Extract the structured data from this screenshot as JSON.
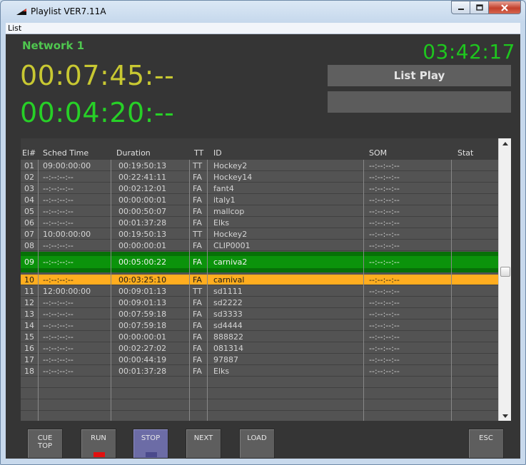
{
  "window": {
    "title": "Playlist VER7.11A"
  },
  "menu": {
    "items": [
      "List"
    ]
  },
  "header": {
    "network": "Network 1",
    "clock": "03:42:17",
    "timecode_elapsed": "00:07:45:--",
    "timecode_remaining": "00:04:20:--",
    "status": "List Play",
    "info": ""
  },
  "playlist": {
    "columns": [
      "El#",
      "Sched Time",
      "Duration",
      "TT",
      "ID",
      "SOM",
      "Stat"
    ],
    "rows": [
      {
        "el": "01",
        "sched": "09:00:00:00",
        "dur": "00:19:50:13",
        "tt": "TT",
        "id": "Hockey2",
        "som": "--:--:--:--",
        "stat": ""
      },
      {
        "el": "02",
        "sched": "--:--:--:--",
        "dur": "00:22:41:11",
        "tt": "FA",
        "id": "Hockey14",
        "som": "--:--:--:--",
        "stat": ""
      },
      {
        "el": "03",
        "sched": "--:--:--:--",
        "dur": "00:02:12:01",
        "tt": "FA",
        "id": "fant4",
        "som": "--:--:--:--",
        "stat": ""
      },
      {
        "el": "04",
        "sched": "--:--:--:--",
        "dur": "00:00:00:01",
        "tt": "FA",
        "id": "italy1",
        "som": "--:--:--:--",
        "stat": ""
      },
      {
        "el": "05",
        "sched": "--:--:--:--",
        "dur": "00:00:50:07",
        "tt": "FA",
        "id": "mallcop",
        "som": "--:--:--:--",
        "stat": ""
      },
      {
        "el": "06",
        "sched": "--:--:--:--",
        "dur": "00:01:37:28",
        "tt": "FA",
        "id": "Elks",
        "som": "--:--:--:--",
        "stat": ""
      },
      {
        "el": "07",
        "sched": "10:00:00:00",
        "dur": "00:19:50:13",
        "tt": "TT",
        "id": "Hockey2",
        "som": "--:--:--:--",
        "stat": ""
      },
      {
        "el": "08",
        "sched": "--:--:--:--",
        "dur": "00:00:00:01",
        "tt": "FA",
        "id": "CLIP0001",
        "som": "--:--:--:--",
        "stat": ""
      },
      {
        "el": "09",
        "sched": "--:--:--:--",
        "dur": "00:05:00:22",
        "tt": "FA",
        "id": "carniva2",
        "som": "--:--:--:--",
        "stat": "",
        "state": "playing"
      },
      {
        "el": "10",
        "sched": "--:--:--:--",
        "dur": "00:03:25:10",
        "tt": "FA",
        "id": "carnival",
        "som": "--:--:--:--",
        "stat": "",
        "state": "cued"
      },
      {
        "el": "11",
        "sched": "12:00:00:00",
        "dur": "00:09:01:13",
        "tt": "TT",
        "id": "sd1111",
        "som": "--:--:--:--",
        "stat": ""
      },
      {
        "el": "12",
        "sched": "--:--:--:--",
        "dur": "00:09:01:13",
        "tt": "FA",
        "id": "sd2222",
        "som": "--:--:--:--",
        "stat": ""
      },
      {
        "el": "13",
        "sched": "--:--:--:--",
        "dur": "00:07:59:18",
        "tt": "FA",
        "id": "sd3333",
        "som": "--:--:--:--",
        "stat": ""
      },
      {
        "el": "14",
        "sched": "--:--:--:--",
        "dur": "00:07:59:18",
        "tt": "FA",
        "id": "sd4444",
        "som": "--:--:--:--",
        "stat": ""
      },
      {
        "el": "15",
        "sched": "--:--:--:--",
        "dur": "00:00:00:01",
        "tt": "FA",
        "id": "888822",
        "som": "--:--:--:--",
        "stat": ""
      },
      {
        "el": "16",
        "sched": "--:--:--:--",
        "dur": "00:02:27:02",
        "tt": "FA",
        "id": "081314",
        "som": "--:--:--:--",
        "stat": ""
      },
      {
        "el": "17",
        "sched": "--:--:--:--",
        "dur": "00:00:44:19",
        "tt": "FA",
        "id": "97887",
        "som": "--:--:--:--",
        "stat": ""
      },
      {
        "el": "18",
        "sched": "--:--:--:--",
        "dur": "00:01:37:28",
        "tt": "FA",
        "id": "Elks",
        "som": "--:--:--:--",
        "stat": ""
      },
      {
        "el": "",
        "sched": "",
        "dur": "",
        "tt": "",
        "id": "",
        "som": "",
        "stat": ""
      },
      {
        "el": "",
        "sched": "",
        "dur": "",
        "tt": "",
        "id": "",
        "som": "",
        "stat": ""
      },
      {
        "el": "",
        "sched": "",
        "dur": "",
        "tt": "",
        "id": "",
        "som": "",
        "stat": ""
      },
      {
        "el": "",
        "sched": "",
        "dur": "",
        "tt": "",
        "id": "",
        "som": "",
        "stat": ""
      },
      {
        "el": "",
        "sched": "",
        "dur": "",
        "tt": "",
        "id": "",
        "som": "",
        "stat": ""
      },
      {
        "el": "",
        "sched": "",
        "dur": "",
        "tt": "",
        "id": "",
        "som": "",
        "stat": ""
      }
    ]
  },
  "controls": {
    "cue_top": "CUE\nTOP",
    "run": "RUN",
    "stop": "STOP",
    "next": "NEXT",
    "load": "LOAD",
    "esc": "ESC"
  },
  "colors": {
    "playing_row": "#0b930b",
    "cued_row": "#ffad1f",
    "run_lamp": "#e11010",
    "stop_lamp": "#4a4a8c",
    "clock": "#1ec61e",
    "elapsed": "#c8c832",
    "remaining": "#27d027"
  }
}
